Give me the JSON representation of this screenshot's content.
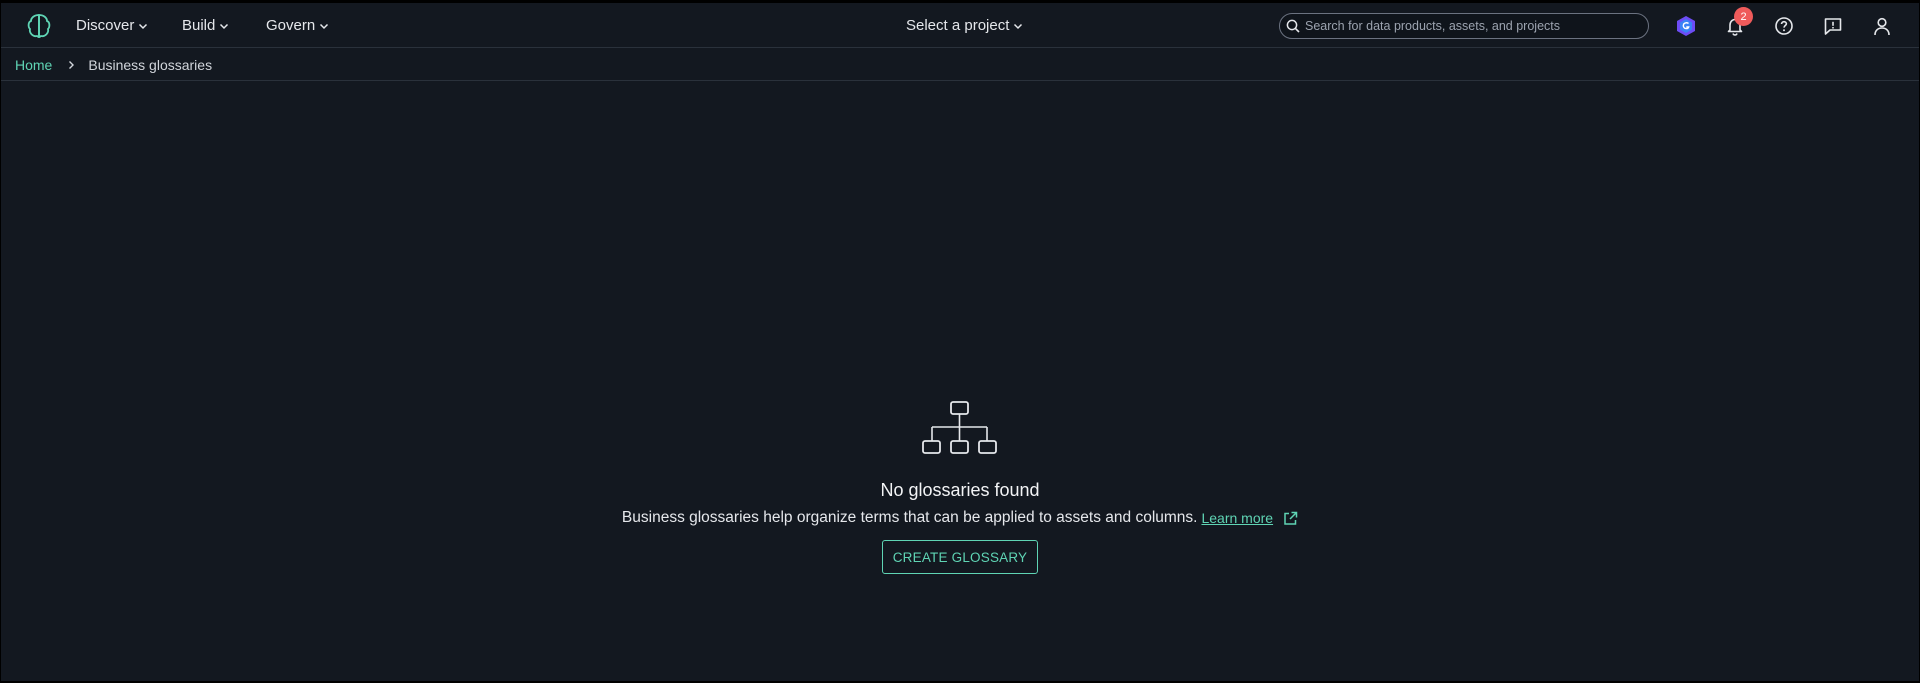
{
  "nav": {
    "items": [
      {
        "label": "Discover"
      },
      {
        "label": "Build"
      },
      {
        "label": "Govern"
      }
    ],
    "project_selector": "Select a project",
    "search_placeholder": "Search for data products, assets, and projects",
    "notifications_count": "2"
  },
  "breadcrumb": {
    "home": "Home",
    "current": "Business glossaries"
  },
  "empty_state": {
    "title": "No glossaries found",
    "description": "Business glossaries help organize terms that can be applied to assets and columns.",
    "learn_more": "Learn more",
    "button": "CREATE GLOSSARY"
  },
  "colors": {
    "accent": "#5fd4b4",
    "background": "#131820",
    "badge": "#ef5b5b"
  }
}
